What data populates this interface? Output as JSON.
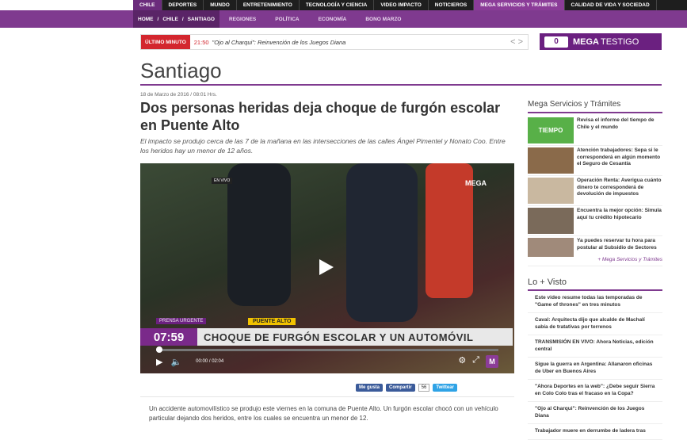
{
  "top_nav": [
    "CHILE",
    "DEPORTES",
    "MUNDO",
    "ENTRETENIMIENTO",
    "TECNOLOGÍA Y CIENCIA",
    "VIDEO IMPACTO",
    "NOTICIEROS",
    "MEGA SERVICIOS Y TRÁMITES",
    "CALIDAD DE VIDA Y SOCIEDAD"
  ],
  "breadcrumb": [
    "HOME",
    "/",
    "CHILE",
    "/",
    "SANTIAGO"
  ],
  "sub_nav": [
    "REGIONES",
    "POLÍTICA",
    "ECONOMÍA",
    "BONO MARZO"
  ],
  "breaking": {
    "tag": "ÚLTIMO MINUTO",
    "time": "21:50",
    "text": "\"Ojo al Charqui\": Reinvención de los Juegos Diana",
    "arrows": "< >"
  },
  "mega_testigo": {
    "logo": "0",
    "brand": "MEGA",
    "label": "TESTIGO"
  },
  "section_title": "Santiago",
  "article": {
    "date": "18 de Marzo de 2016 / 08:01 Hrs.",
    "headline": "Dos personas heridas deja choque de furgón escolar en Puente Alto",
    "lede": "El impacto se produjo cerca de las 7 de la mañana en las intersecciones de las calles Ángel Pimentel y Nonato Coo. Entre los heridos hay un menor de 12 años.",
    "body": "Un accidente automovilístico se produjo este viernes en la comuna de Puente Alto. Un furgón escolar chocó con un vehículo particular dejando dos heridos, entre los cuales se encuentra un menor de 12."
  },
  "video": {
    "live_tag": "EN VIVO",
    "watermark": "MEGA",
    "urgent": "PRENSA URGENTE",
    "place": "PUENTE ALTO",
    "clock": "07:59",
    "lower_headline": "CHOQUE DE FURGÓN ESCOLAR Y UN AUTOMÓVIL",
    "time_display": "00:00 / 02:04",
    "progress": 0
  },
  "share": {
    "fb": "Me gusta",
    "fb_share": "Compartir",
    "count": "56",
    "tw": "Twittear"
  },
  "sidebar": {
    "services_title": "Mega Servicios y Trámites",
    "services": [
      {
        "text": "Revisa el informe del tiempo de Chile y el mundo",
        "thumb_label": "TIEMPO",
        "color": "#58b048"
      },
      {
        "text": "Atención trabajadores: Sepa si le corresponderá en algún momento el Seguro de Cesantía",
        "thumb_label": "",
        "color": "#8a6a4a"
      },
      {
        "text": "Operación Renta: Averigua cuánto dinero te corresponderá de devolución de impuestos",
        "thumb_label": "",
        "color": "#c9b8a0"
      },
      {
        "text": "Encuentra la mejor opción: Simula aquí tu crédito hipotecario",
        "thumb_label": "",
        "color": "#7a6a5a"
      },
      {
        "text": "Ya puedes reservar tu hora para postular al Subsidio de Sectores",
        "thumb_label": "",
        "color": "#a08a7a"
      }
    ],
    "services_more": "+ Mega Servicios y Trámites",
    "visto_title": "Lo + Visto",
    "visto": [
      "Este video resume todas las temporadas de \"Game of thrones\" en tres minutos",
      "Caval: Arquitecta dijo que alcalde de Machalí sabía de tratativas por terrenos",
      "TRANSMISIÓN EN VIVO: Ahora Noticias, edición central",
      "Sigue la guerra en Argentina: Allanaron oficinas de Uber en Buenos Aires",
      "\"Ahora Deportes en la web\": ¿Debe seguir Sierra en Colo Colo tras el fracaso en la Copa?",
      "\"Ojo al Charqui\": Reinvención de los Juegos Diana",
      "Trabajador muere en derrumbe de ladera tras"
    ]
  }
}
